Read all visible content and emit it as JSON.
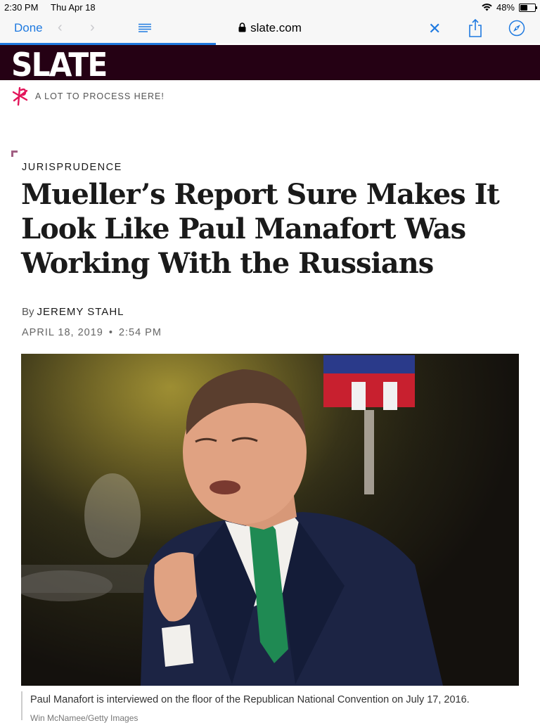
{
  "status_bar": {
    "time": "2:30 PM",
    "date": "Thu Apr 18",
    "battery": "48%",
    "battery_level": 0.48
  },
  "toolbar": {
    "done_label": "Done",
    "url": "slate.com"
  },
  "page_load_progress": 0.4,
  "site": {
    "logo": "SLATE",
    "promo": "A LOT TO PROCESS HERE!"
  },
  "article": {
    "kicker": "JURISPRUDENCE",
    "headline": "Mueller’s Report Sure Makes It Look Like Paul Manafort Was Working With the Russians",
    "byline_prefix": "By",
    "author": "JEREMY STAHL",
    "date": "APRIL 18, 2019",
    "time": "2:54 PM",
    "caption": "Paul Manafort is interviewed on the floor of the Republican National Convention on July 17, 2016.",
    "credit": "Win McNamee/Getty Images"
  },
  "colors": {
    "accent": "#1f7ae0",
    "masthead": "#250114",
    "promo": "#e3155a"
  },
  "icons": [
    "wifi-icon",
    "battery-icon",
    "back-icon",
    "forward-icon",
    "reader-icon",
    "lock-icon",
    "close-icon",
    "share-icon",
    "compass-icon",
    "promo-icon"
  ]
}
